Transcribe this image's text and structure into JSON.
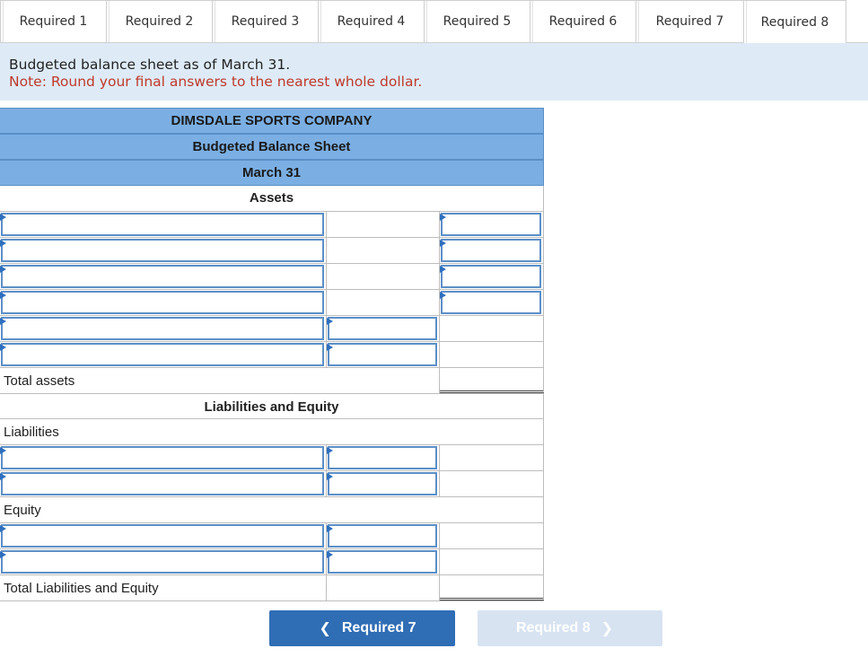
{
  "tabs": [
    {
      "label": "Required 1"
    },
    {
      "label": "Required 2"
    },
    {
      "label": "Required 3"
    },
    {
      "label": "Required 4"
    },
    {
      "label": "Required 5"
    },
    {
      "label": "Required 6"
    },
    {
      "label": "Required 7"
    },
    {
      "label": "Required 8",
      "active": true
    }
  ],
  "banner": {
    "instruction": "Budgeted balance sheet as of March 31.",
    "note": "Note: Round your final answers to the nearest whole dollar."
  },
  "sheet": {
    "company": "DIMSDALE SPORTS COMPANY",
    "title": "Budgeted Balance Sheet",
    "date": "March 31",
    "assets_heading": "Assets",
    "total_assets_label": "Total assets",
    "liab_equity_heading": "Liabilities and Equity",
    "liabilities_label": "Liabilities",
    "equity_label": "Equity",
    "total_le_label": "Total Liabilities and Equity"
  },
  "nav": {
    "prev_label": "Required 7",
    "next_label": "Required 8",
    "prev_icon": "chevron-left-icon",
    "next_icon": "chevron-right-icon"
  },
  "colors": {
    "header_blue": "#7bafe3",
    "banner_bg": "#deebf7",
    "note_red": "#c0392b",
    "input_border": "#5c8fc7",
    "button_blue": "#2f6db5",
    "button_disabled": "#d7e3f1"
  }
}
